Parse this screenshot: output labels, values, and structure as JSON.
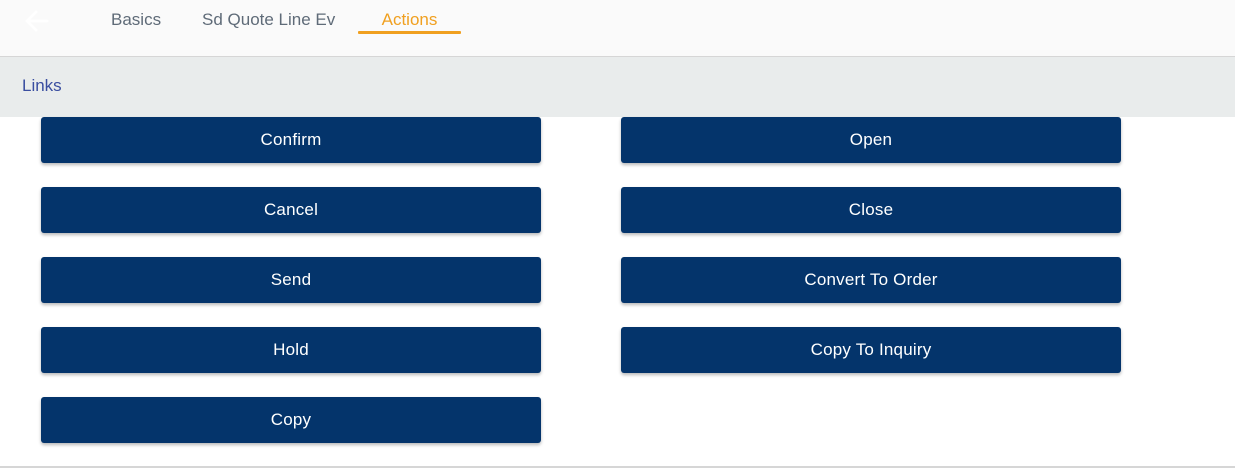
{
  "nav": {
    "back_icon": "arrow-left-icon",
    "tabs": [
      {
        "label": "Basics",
        "active": false
      },
      {
        "label": "Sd Quote Line Ev",
        "active": false
      },
      {
        "label": "Actions",
        "active": true
      }
    ],
    "active_color": "#f0a020"
  },
  "section": {
    "title": "Links"
  },
  "actions": {
    "left": [
      "Confirm",
      "Cancel",
      "Send",
      "Hold",
      "Copy"
    ],
    "right": [
      "Open",
      "Close",
      "Convert To Order",
      "Copy To Inquiry"
    ]
  },
  "colors": {
    "button_bg": "#04346b",
    "section_title": "#3a4ea0"
  }
}
